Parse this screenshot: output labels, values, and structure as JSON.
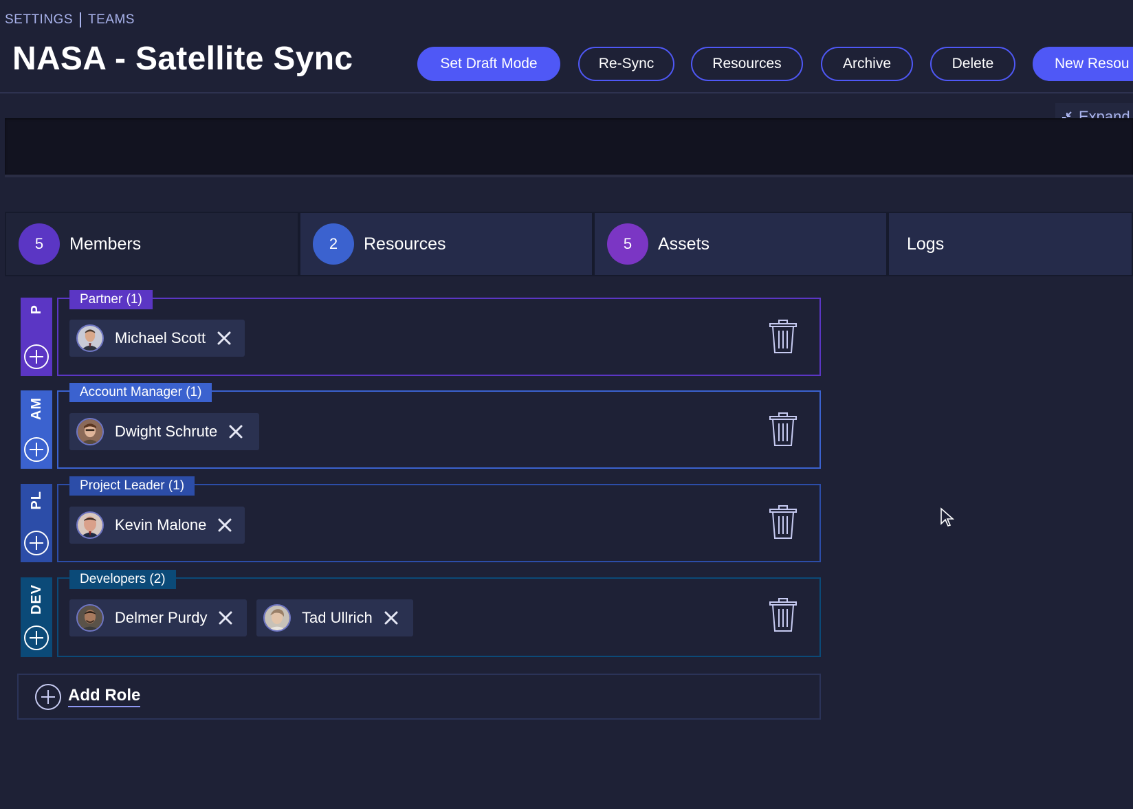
{
  "breadcrumb": {
    "items": [
      "SETTINGS",
      "TEAMS"
    ]
  },
  "page": {
    "title": "NASA - Satellite Sync"
  },
  "toolbar": {
    "set_draft_mode": "Set Draft Mode",
    "re_sync": "Re-Sync",
    "resources": "Resources",
    "archive": "Archive",
    "delete": "Delete",
    "new_resource": "New Resou"
  },
  "expand": {
    "label": "Expand"
  },
  "tabs": [
    {
      "count": "5",
      "label": "Members",
      "color": "#5b36c4"
    },
    {
      "count": "2",
      "label": "Resources",
      "color": "#3b62cf"
    },
    {
      "count": "5",
      "label": "Assets",
      "color": "#7b36c4"
    },
    {
      "count": "",
      "label": "Logs",
      "color": ""
    }
  ],
  "roles": [
    {
      "abbr": "P",
      "tag": "Partner (1)",
      "color": "#5b36c4",
      "members": [
        {
          "name": "Michael Scott",
          "avatar": "avatar-michael"
        }
      ]
    },
    {
      "abbr": "AM",
      "tag": "Account Manager (1)",
      "color": "#3b62cf",
      "members": [
        {
          "name": "Dwight Schrute",
          "avatar": "avatar-dwight"
        }
      ]
    },
    {
      "abbr": "PL",
      "tag": "Project Leader (1)",
      "color": "#2c4da8",
      "members": [
        {
          "name": "Kevin Malone",
          "avatar": "avatar-kevin"
        }
      ]
    },
    {
      "abbr": "DEV",
      "tag": "Developers (2)",
      "color": "#0b4a78",
      "members": [
        {
          "name": "Delmer Purdy",
          "avatar": "avatar-delmer"
        },
        {
          "name": "Tad Ullrich",
          "avatar": "avatar-tad"
        }
      ]
    }
  ],
  "add_role": {
    "label": "Add Role"
  },
  "colors": {
    "accent": "#4f58f6",
    "background": "#1e2136",
    "panel": "#121320",
    "muted_text": "#a9b3ec"
  },
  "icons": {
    "expand": "collapse-arrows-icon",
    "trash": "trash-icon",
    "add": "plus-circle-icon",
    "remove": "close-icon",
    "cursor": "mouse-pointer-icon"
  }
}
